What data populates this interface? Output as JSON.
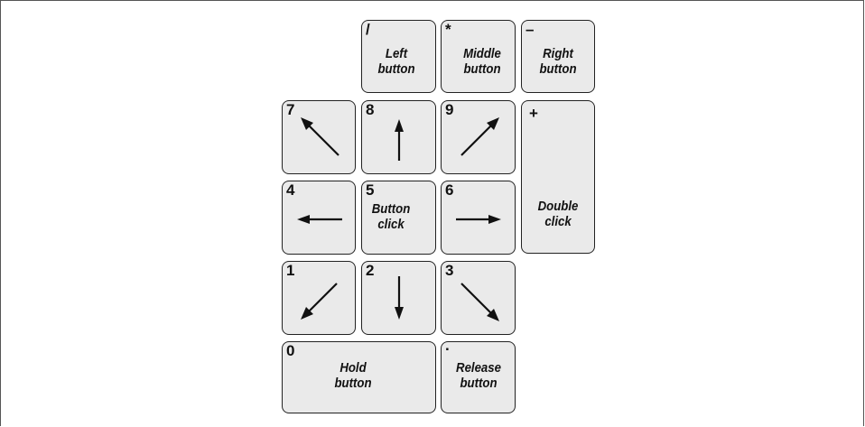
{
  "keys": {
    "slash": {
      "symbol": "/",
      "label": "Left\nbutton"
    },
    "star": {
      "symbol": "*",
      "label": "Middle\nbutton"
    },
    "minus": {
      "symbol": "–",
      "label": "Right\nbutton"
    },
    "k7": {
      "symbol": "7",
      "arrow": "up-left"
    },
    "k8": {
      "symbol": "8",
      "arrow": "up"
    },
    "k9": {
      "symbol": "9",
      "arrow": "up-right"
    },
    "plus": {
      "symbol": "+",
      "label": "Double\nclick"
    },
    "k4": {
      "symbol": "4",
      "arrow": "left"
    },
    "k5": {
      "symbol": "5",
      "label": "Button\nclick"
    },
    "k6": {
      "symbol": "6",
      "arrow": "right"
    },
    "k1": {
      "symbol": "1",
      "arrow": "down-left"
    },
    "k2": {
      "symbol": "2",
      "arrow": "down"
    },
    "k3": {
      "symbol": "3",
      "arrow": "down-right"
    },
    "k0": {
      "symbol": "0",
      "label": "Hold\nbutton"
    },
    "dot": {
      "symbol": ".",
      "label": "Release\nbutton"
    }
  }
}
